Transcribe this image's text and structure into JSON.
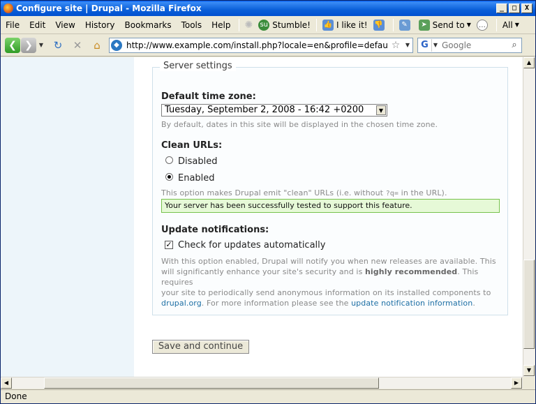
{
  "window": {
    "title": "Configure site | Drupal - Mozilla Firefox",
    "minimize": "_",
    "maximize": "□",
    "close": "X"
  },
  "menu": [
    "File",
    "Edit",
    "View",
    "History",
    "Bookmarks",
    "Tools",
    "Help"
  ],
  "toolbar": {
    "stumble": "Stumble!",
    "like": "I like it!",
    "sendto": "Send to",
    "all": "All"
  },
  "nav": {
    "url": "http://www.example.com/install.php?locale=en&profile=default",
    "search_placeholder": "Google",
    "search_engine": "G"
  },
  "form": {
    "legend": "Server settings",
    "timezone_label": "Default time zone:",
    "timezone_value": "Tuesday, September 2, 2008 - 16:42 +0200",
    "timezone_desc": "By default, dates in this site will be displayed in the chosen time zone.",
    "clean_label": "Clean URLs:",
    "clean_options": [
      "Disabled",
      "Enabled"
    ],
    "clean_selected": "Enabled",
    "clean_desc_a": "This option makes Drupal emit \"clean\" URLs (i.e. without ",
    "clean_desc_code": "?q=",
    "clean_desc_b": " in the URL).",
    "success_msg": "Your server has been successfully tested to support this feature.",
    "update_label": "Update notifications:",
    "update_checkbox": "Check for updates automatically",
    "update_checked": true,
    "update_desc_1": "With this option enabled, Drupal will notify you when new releases are available. This",
    "update_desc_2a": "will significantly enhance your site's security and is ",
    "update_desc_2b": "highly recommended",
    "update_desc_2c": ". This requires",
    "update_desc_3": "your site to periodically send anonymous information on its installed components to",
    "update_link1": "drupal.org",
    "update_desc_4": ". For more information please see the ",
    "update_link2": "update notification information",
    "update_desc_5": ".",
    "save_button": "Save and continue"
  },
  "status": "Done"
}
